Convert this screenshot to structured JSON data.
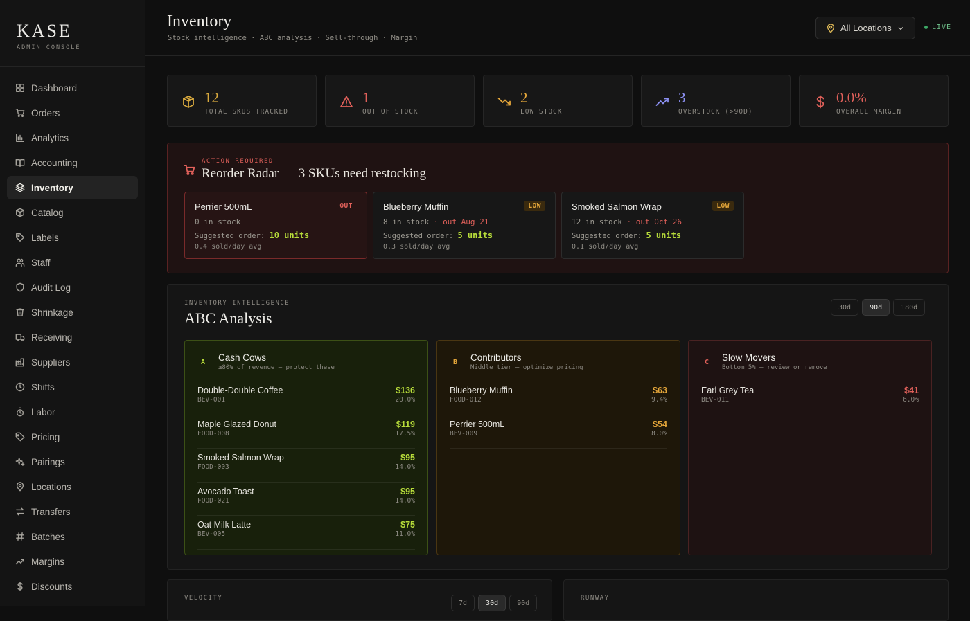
{
  "brand": {
    "name": "KASE",
    "subtitle": "ADMIN CONSOLE"
  },
  "sidebar": {
    "items": [
      {
        "label": "Dashboard",
        "icon": "grid-icon"
      },
      {
        "label": "Orders",
        "icon": "cart-icon"
      },
      {
        "label": "Analytics",
        "icon": "bar-chart-icon"
      },
      {
        "label": "Accounting",
        "icon": "book-icon"
      },
      {
        "label": "Inventory",
        "icon": "layers-icon",
        "active": true
      },
      {
        "label": "Catalog",
        "icon": "box-icon"
      },
      {
        "label": "Labels",
        "icon": "tag-icon"
      },
      {
        "label": "Staff",
        "icon": "users-icon"
      },
      {
        "label": "Audit Log",
        "icon": "shield-icon"
      },
      {
        "label": "Shrinkage",
        "icon": "trash-icon"
      },
      {
        "label": "Receiving",
        "icon": "truck-icon"
      },
      {
        "label": "Suppliers",
        "icon": "factory-icon"
      },
      {
        "label": "Shifts",
        "icon": "clock-icon"
      },
      {
        "label": "Labor",
        "icon": "timer-icon"
      },
      {
        "label": "Pricing",
        "icon": "price-tag-icon"
      },
      {
        "label": "Pairings",
        "icon": "sparkle-icon"
      },
      {
        "label": "Locations",
        "icon": "map-pin-icon"
      },
      {
        "label": "Transfers",
        "icon": "arrows-icon"
      },
      {
        "label": "Batches",
        "icon": "hash-icon"
      },
      {
        "label": "Margins",
        "icon": "trend-up-icon"
      },
      {
        "label": "Discounts",
        "icon": "dollar-icon"
      }
    ]
  },
  "header": {
    "title": "Inventory",
    "subtitle": "Stock intelligence · ABC analysis · Sell-through · Margin",
    "location_select": "All Locations",
    "live_label": "LIVE"
  },
  "kpis": [
    {
      "value": "12",
      "label": "TOTAL SKUS TRACKED",
      "icon": "box-icon",
      "color": "#d8a93e"
    },
    {
      "value": "1",
      "label": "OUT OF STOCK",
      "icon": "alert-triangle-icon",
      "color": "#e0605a"
    },
    {
      "value": "2",
      "label": "LOW STOCK",
      "icon": "trend-down-icon",
      "color": "#e4a63a"
    },
    {
      "value": "3",
      "label": "OVERSTOCK (>90D)",
      "icon": "trend-up-icon",
      "color": "#8b8ff0"
    },
    {
      "value": "0.0%",
      "label": "OVERALL MARGIN",
      "icon": "dollar-icon",
      "color": "#e0605a"
    }
  ],
  "radar": {
    "tag": "ACTION REQUIRED",
    "title": "Reorder Radar — 3 SKUs need restocking",
    "cards": [
      {
        "name": "Perrier 500mL",
        "badge": "OUT",
        "stock": "0 in stock",
        "out_date": "",
        "suggest_label": "Suggested order:",
        "suggest_value": "10 units",
        "rate": "0.4 sold/day avg"
      },
      {
        "name": "Blueberry Muffin",
        "badge": "LOW",
        "stock": "8 in stock",
        "out_date": "· out Aug 21",
        "suggest_label": "Suggested order:",
        "suggest_value": "5 units",
        "rate": "0.3 sold/day avg"
      },
      {
        "name": "Smoked Salmon Wrap",
        "badge": "LOW",
        "stock": "12 in stock",
        "out_date": "· out Oct 26",
        "suggest_label": "Suggested order:",
        "suggest_value": "5 units",
        "rate": "0.1 sold/day avg"
      }
    ]
  },
  "abc": {
    "tag": "INVENTORY INTELLIGENCE",
    "title": "ABC Analysis",
    "ranges": [
      "30d",
      "90d",
      "180d"
    ],
    "active_range": "90d",
    "tiers": [
      {
        "letter": "A",
        "name": "Cash Cows",
        "desc": "≥80% of revenue — protect these",
        "color": "#b7dc3a",
        "items": [
          {
            "name": "Double-Double Coffee",
            "sku": "BEV-001",
            "value": "$136",
            "pct": "20.0%"
          },
          {
            "name": "Maple Glazed Donut",
            "sku": "FOOD-008",
            "value": "$119",
            "pct": "17.5%"
          },
          {
            "name": "Smoked Salmon Wrap",
            "sku": "FOOD-003",
            "value": "$95",
            "pct": "14.0%"
          },
          {
            "name": "Avocado Toast",
            "sku": "FOOD-021",
            "value": "$95",
            "pct": "14.0%"
          },
          {
            "name": "Oat Milk Latte",
            "sku": "BEV-005",
            "value": "$75",
            "pct": "11.0%"
          }
        ]
      },
      {
        "letter": "B",
        "name": "Contributors",
        "desc": "Middle tier — optimize pricing",
        "color": "#e4a63a",
        "items": [
          {
            "name": "Blueberry Muffin",
            "sku": "FOOD-012",
            "value": "$63",
            "pct": "9.4%"
          },
          {
            "name": "Perrier 500mL",
            "sku": "BEV-009",
            "value": "$54",
            "pct": "8.0%"
          }
        ]
      },
      {
        "letter": "C",
        "name": "Slow Movers",
        "desc": "Bottom 5% — review or remove",
        "color": "#e0605a",
        "items": [
          {
            "name": "Earl Grey Tea",
            "sku": "BEV-011",
            "value": "$41",
            "pct": "6.0%"
          }
        ]
      }
    ]
  },
  "velocity": {
    "tag": "VELOCITY",
    "ranges": [
      "7d",
      "30d",
      "90d"
    ],
    "active_range": "30d"
  },
  "runway": {
    "tag": "RUNWAY"
  }
}
